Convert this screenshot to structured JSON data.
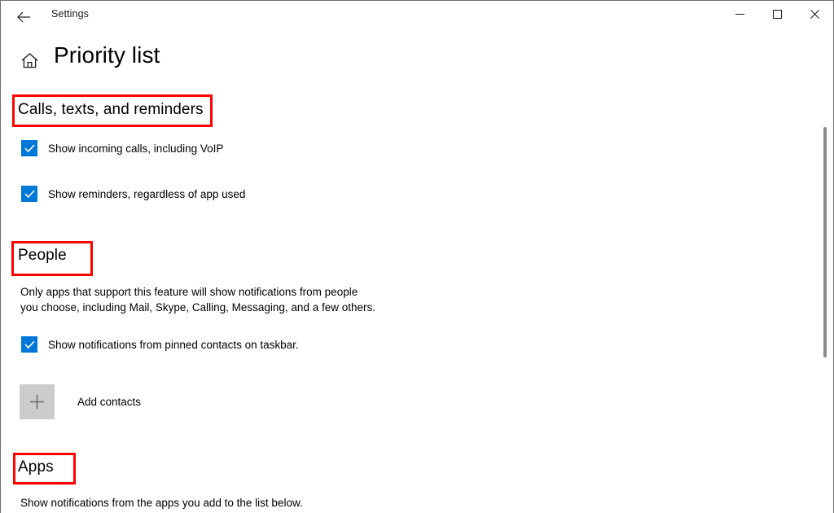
{
  "window": {
    "app_title": "Settings",
    "back_icon": "back-arrow-icon",
    "minimize_label": "─",
    "maximize_label": "□",
    "close_label": "✕"
  },
  "page": {
    "home_icon": "home-icon",
    "title": "Priority list"
  },
  "sections": {
    "calls": {
      "heading": "Calls, texts, and reminders",
      "checkboxes": [
        {
          "label": "Show incoming calls, including VoIP",
          "checked": true
        },
        {
          "label": "Show reminders, regardless of app used",
          "checked": true
        }
      ]
    },
    "people": {
      "heading": "People",
      "description_line1": "Only apps that support this feature will show notifications from people",
      "description_line2": "you choose, including Mail, Skype, Calling, Messaging, and a few others.",
      "checkbox": {
        "label": "Show notifications from pinned contacts on taskbar.",
        "checked": true
      },
      "add_contacts_label": "Add contacts",
      "add_contacts_icon": "plus-icon"
    },
    "apps": {
      "heading": "Apps",
      "description": "Show notifications from the apps you add to the list below."
    }
  },
  "annotations": {
    "color": "#fe0000",
    "boxes": [
      {
        "target": "Calls, texts, and reminders"
      },
      {
        "target": "People"
      },
      {
        "target": "Apps"
      }
    ]
  },
  "colors": {
    "accent": "#0078d7",
    "tile": "#cccccc",
    "text": "#000000",
    "scrollbar_thumb": "#8a8a8a"
  }
}
